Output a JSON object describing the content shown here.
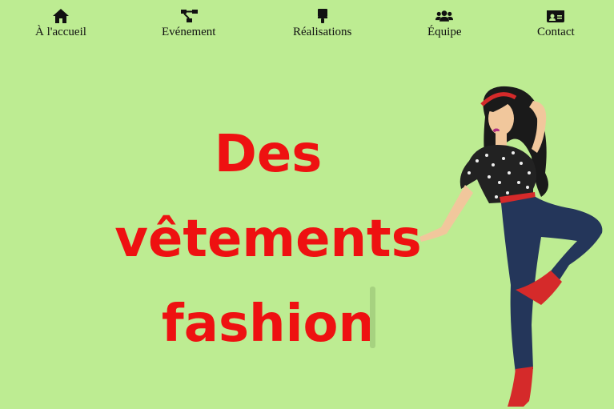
{
  "nav": {
    "items": [
      {
        "label": "À l'accueil",
        "icon": "home-icon"
      },
      {
        "label": "Evénement",
        "icon": "sitemap-icon"
      },
      {
        "label": "Réalisations",
        "icon": "paint-brush-icon"
      },
      {
        "label": "Équipe",
        "icon": "users-icon"
      },
      {
        "label": "Contact",
        "icon": "id-card-icon"
      }
    ]
  },
  "hero": {
    "lines": [
      "Des",
      "vêtements",
      "fashion"
    ]
  },
  "colors": {
    "background": "#bdec92",
    "headline": "#ee1111",
    "nav_text": "#111111"
  }
}
